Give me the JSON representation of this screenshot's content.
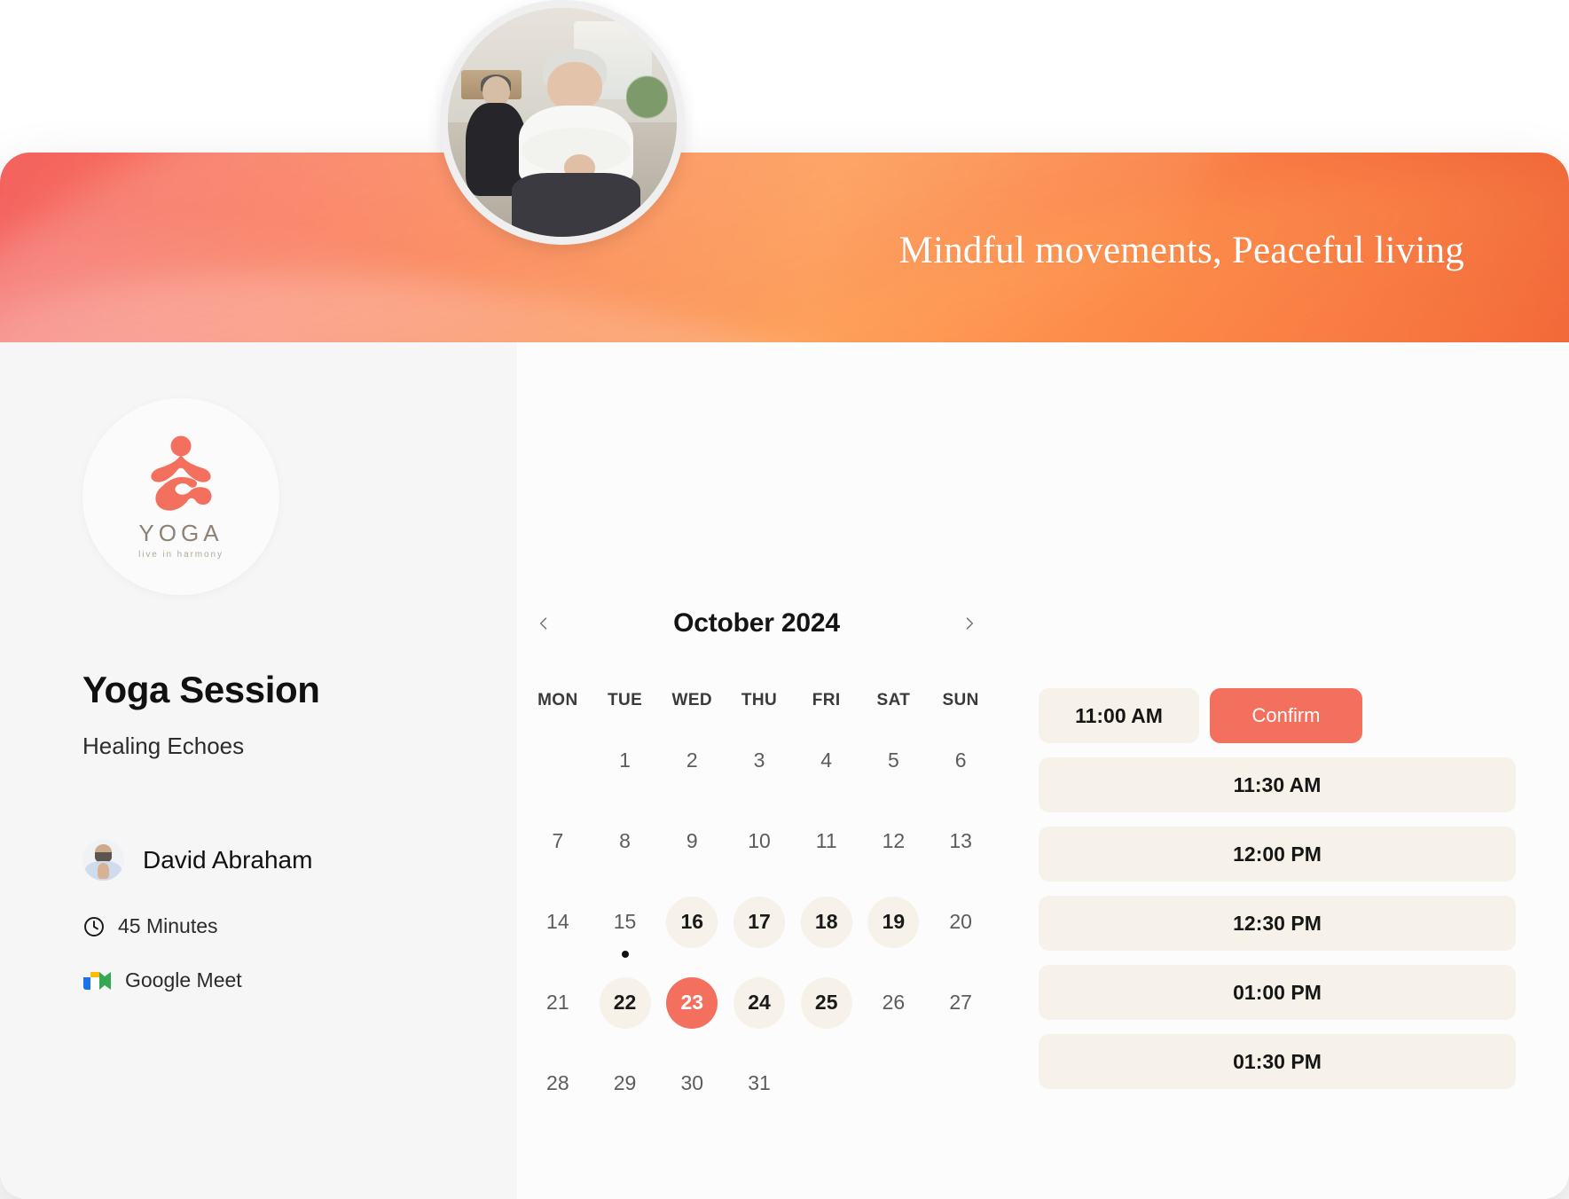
{
  "banner": {
    "tagline": "Mindful movements, Peaceful living"
  },
  "brand": {
    "name": "YOGA",
    "sub": "live in harmony",
    "logo_icon": "meditating-person-icon"
  },
  "session": {
    "title": "Yoga Session",
    "subtitle": "Healing Echoes",
    "host_name": "David Abraham",
    "duration": "45 Minutes",
    "platform": "Google Meet",
    "duration_icon": "clock-icon",
    "platform_icon": "google-meet-icon"
  },
  "calendar": {
    "month_label": "October 2024",
    "prev_icon": "chevron-left-icon",
    "next_icon": "chevron-right-icon",
    "weekdays": [
      "MON",
      "TUE",
      "WED",
      "THU",
      "FRI",
      "SAT",
      "SUN"
    ],
    "lead_blanks": 1,
    "days": [
      {
        "n": "1"
      },
      {
        "n": "2"
      },
      {
        "n": "3"
      },
      {
        "n": "4"
      },
      {
        "n": "5"
      },
      {
        "n": "6"
      },
      {
        "n": "7"
      },
      {
        "n": "8"
      },
      {
        "n": "9"
      },
      {
        "n": "10"
      },
      {
        "n": "11"
      },
      {
        "n": "12"
      },
      {
        "n": "13"
      },
      {
        "n": "14"
      },
      {
        "n": "15",
        "today": true
      },
      {
        "n": "16",
        "available": true
      },
      {
        "n": "17",
        "available": true
      },
      {
        "n": "18",
        "available": true
      },
      {
        "n": "19",
        "available": true
      },
      {
        "n": "20"
      },
      {
        "n": "21"
      },
      {
        "n": "22",
        "available": true
      },
      {
        "n": "23",
        "selected": true
      },
      {
        "n": "24",
        "available": true
      },
      {
        "n": "25",
        "available": true
      },
      {
        "n": "26"
      },
      {
        "n": "27"
      },
      {
        "n": "28"
      },
      {
        "n": "29"
      },
      {
        "n": "30"
      },
      {
        "n": "31"
      }
    ]
  },
  "time_slots": {
    "selected": "11:00 AM",
    "confirm_label": "Confirm",
    "options": [
      "11:00 AM",
      "11:30 AM",
      "12:00 PM",
      "12:30 PM",
      "01:00 PM",
      "01:30 PM"
    ]
  },
  "colors": {
    "accent": "#F4705E",
    "slot_bg": "#F6F2EA",
    "banner_start": "#F4625F",
    "banner_end": "#EF6236"
  }
}
